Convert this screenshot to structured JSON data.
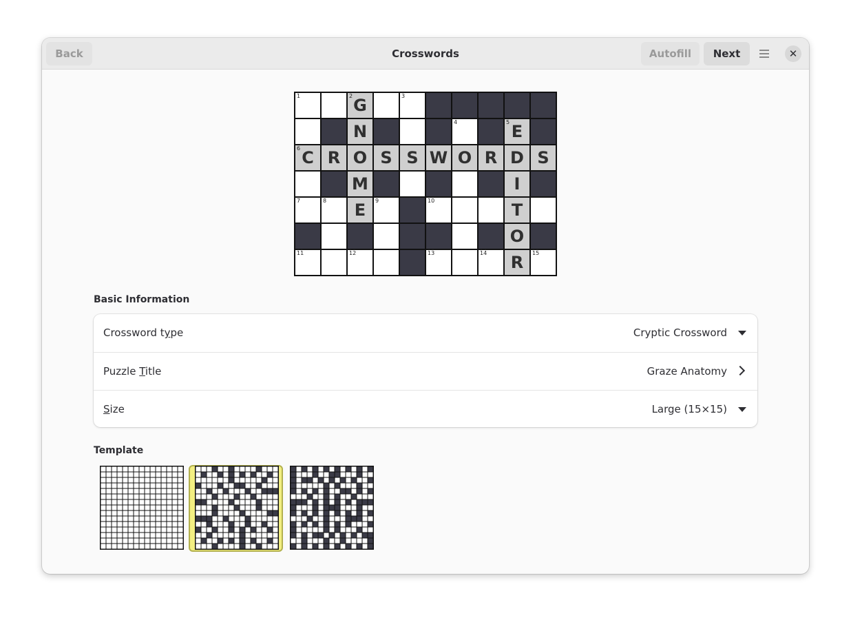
{
  "window": {
    "title": "Crosswords",
    "back_label": "Back",
    "autofill_label": "Autofill",
    "next_label": "Next",
    "menu_icon": "hamburger-menu-icon",
    "close_icon": "close-icon",
    "close_glyph": "✕"
  },
  "preview": {
    "rows": [
      [
        {
          "n": "1"
        },
        {},
        {
          "n": "2",
          "l": "G",
          "h": 1
        },
        {},
        {
          "n": "3"
        },
        {
          "b": 1
        },
        {
          "b": 1
        },
        {
          "b": 1
        },
        {
          "b": 1
        },
        {
          "b": 1
        }
      ],
      [
        {},
        {
          "b": 1
        },
        {
          "l": "N",
          "h": 1
        },
        {
          "b": 1
        },
        {},
        {
          "b": 1
        },
        {
          "n": "4"
        },
        {
          "b": 1
        },
        {
          "n": "5",
          "l": "E",
          "h": 1
        },
        {
          "b": 1
        }
      ],
      [
        {
          "n": "6",
          "l": "C",
          "h": 1
        },
        {
          "l": "R",
          "h": 1
        },
        {
          "l": "O",
          "h": 1
        },
        {
          "l": "S",
          "h": 1
        },
        {
          "l": "S",
          "h": 1
        },
        {
          "l": "W",
          "h": 1
        },
        {
          "l": "O",
          "h": 1
        },
        {
          "l": "R",
          "h": 1
        },
        {
          "l": "D",
          "h": 1
        },
        {
          "l": "S",
          "h": 1
        }
      ],
      [
        {},
        {
          "b": 1
        },
        {
          "l": "M",
          "h": 1
        },
        {
          "b": 1
        },
        {},
        {
          "b": 1
        },
        {},
        {
          "b": 1
        },
        {
          "l": "I",
          "h": 1
        },
        {
          "b": 1
        }
      ],
      [
        {
          "n": "7"
        },
        {
          "n": "8"
        },
        {
          "l": "E",
          "h": 1
        },
        {
          "n": "9"
        },
        {
          "b": 1
        },
        {
          "n": "10"
        },
        {},
        {},
        {
          "l": "T",
          "h": 1
        },
        {}
      ],
      [
        {
          "b": 1
        },
        {},
        {
          "b": 1
        },
        {},
        {
          "b": 1
        },
        {
          "b": 1
        },
        {},
        {
          "b": 1
        },
        {
          "l": "O",
          "h": 1
        },
        {
          "b": 1
        }
      ],
      [
        {
          "n": "11"
        },
        {},
        {
          "n": "12"
        },
        {},
        {
          "b": 1
        },
        {
          "n": "13"
        },
        {},
        {
          "n": "14"
        },
        {
          "l": "R",
          "h": 1
        },
        {
          "n": "15"
        }
      ]
    ]
  },
  "basic_info": {
    "heading": "Basic Information",
    "crossword_type": {
      "label_pre": "Crossword t",
      "label_mn": "y",
      "label_post": "pe",
      "value": "Cryptic Crossword"
    },
    "puzzle_title": {
      "label_pre": "Puzzle ",
      "label_mn": "T",
      "label_post": "itle",
      "value": "Graze Anatomy"
    },
    "size": {
      "label_pre": "",
      "label_mn": "S",
      "label_post": "ize",
      "value": "Large (15×15)"
    }
  },
  "template": {
    "heading": "Template",
    "selected_index": 1,
    "items": [
      {
        "name": "template-blank",
        "blocks": []
      },
      {
        "name": "template-sparse",
        "blocks": [
          [
            0,
            3
          ],
          [
            0,
            6
          ],
          [
            0,
            11
          ],
          [
            1,
            1
          ],
          [
            1,
            4
          ],
          [
            1,
            6
          ],
          [
            1,
            8
          ],
          [
            1,
            10
          ],
          [
            1,
            13
          ],
          [
            2,
            6
          ],
          [
            2,
            12
          ],
          [
            3,
            0
          ],
          [
            3,
            4
          ],
          [
            3,
            7
          ],
          [
            3,
            8
          ],
          [
            3,
            11
          ],
          [
            4,
            2
          ],
          [
            4,
            5
          ],
          [
            4,
            9
          ],
          [
            4,
            12
          ],
          [
            4,
            13
          ],
          [
            4,
            14
          ],
          [
            5,
            3
          ],
          [
            5,
            7
          ],
          [
            5,
            10
          ],
          [
            6,
            0
          ],
          [
            6,
            1
          ],
          [
            6,
            6
          ],
          [
            6,
            11
          ],
          [
            7,
            3
          ],
          [
            7,
            7
          ],
          [
            7,
            11
          ],
          [
            8,
            3
          ],
          [
            8,
            8
          ],
          [
            8,
            13
          ],
          [
            8,
            14
          ],
          [
            9,
            0
          ],
          [
            9,
            1
          ],
          [
            9,
            2
          ],
          [
            9,
            5
          ],
          [
            9,
            9
          ],
          [
            10,
            2
          ],
          [
            10,
            6
          ],
          [
            10,
            9
          ],
          [
            10,
            12
          ],
          [
            11,
            0
          ],
          [
            11,
            3
          ],
          [
            11,
            6
          ],
          [
            11,
            8
          ],
          [
            11,
            10
          ],
          [
            11,
            13
          ],
          [
            12,
            2
          ],
          [
            12,
            8
          ],
          [
            13,
            1
          ],
          [
            13,
            4
          ],
          [
            13,
            6
          ],
          [
            13,
            8
          ],
          [
            13,
            10
          ],
          [
            13,
            13
          ],
          [
            14,
            3
          ],
          [
            14,
            8
          ],
          [
            14,
            11
          ]
        ]
      },
      {
        "name": "template-dense",
        "blocks": [
          [
            0,
            0
          ],
          [
            0,
            2
          ],
          [
            0,
            4
          ],
          [
            0,
            6
          ],
          [
            0,
            8
          ],
          [
            0,
            10
          ],
          [
            0,
            12
          ],
          [
            0,
            14
          ],
          [
            1,
            0
          ],
          [
            1,
            4
          ],
          [
            1,
            7
          ],
          [
            1,
            8
          ],
          [
            1,
            12
          ],
          [
            2,
            0
          ],
          [
            2,
            2
          ],
          [
            2,
            3
          ],
          [
            2,
            5
          ],
          [
            2,
            7
          ],
          [
            2,
            9
          ],
          [
            2,
            11
          ],
          [
            2,
            14
          ],
          [
            3,
            0
          ],
          [
            3,
            6
          ],
          [
            3,
            8
          ],
          [
            3,
            12
          ],
          [
            4,
            0
          ],
          [
            4,
            2
          ],
          [
            4,
            4
          ],
          [
            4,
            6
          ],
          [
            4,
            9
          ],
          [
            4,
            10
          ],
          [
            4,
            12
          ],
          [
            4,
            14
          ],
          [
            5,
            3
          ],
          [
            5,
            6
          ],
          [
            5,
            8
          ],
          [
            5,
            11
          ],
          [
            6,
            0
          ],
          [
            6,
            1
          ],
          [
            6,
            2
          ],
          [
            6,
            4
          ],
          [
            6,
            6
          ],
          [
            6,
            8
          ],
          [
            6,
            10
          ],
          [
            6,
            12
          ],
          [
            6,
            13
          ],
          [
            6,
            14
          ],
          [
            7,
            0
          ],
          [
            7,
            4
          ],
          [
            7,
            6
          ],
          [
            7,
            7
          ],
          [
            7,
            8
          ],
          [
            7,
            12
          ],
          [
            8,
            0
          ],
          [
            8,
            2
          ],
          [
            8,
            4
          ],
          [
            8,
            6
          ],
          [
            8,
            8
          ],
          [
            8,
            10
          ],
          [
            8,
            12
          ],
          [
            8,
            14
          ],
          [
            9,
            3
          ],
          [
            9,
            6
          ],
          [
            9,
            10
          ],
          [
            9,
            11
          ],
          [
            9,
            12
          ],
          [
            10,
            0
          ],
          [
            10,
            2
          ],
          [
            10,
            4
          ],
          [
            10,
            6
          ],
          [
            10,
            8
          ],
          [
            10,
            10
          ],
          [
            10,
            14
          ],
          [
            11,
            0
          ],
          [
            11,
            6
          ],
          [
            11,
            8
          ],
          [
            11,
            12
          ],
          [
            12,
            0
          ],
          [
            12,
            2
          ],
          [
            12,
            4
          ],
          [
            12,
            5
          ],
          [
            12,
            7
          ],
          [
            12,
            9
          ],
          [
            12,
            11
          ],
          [
            12,
            13
          ],
          [
            12,
            14
          ],
          [
            13,
            2
          ],
          [
            13,
            6
          ],
          [
            13,
            9
          ],
          [
            13,
            14
          ],
          [
            14,
            0
          ],
          [
            14,
            2
          ],
          [
            14,
            4
          ],
          [
            14,
            6
          ],
          [
            14,
            8
          ],
          [
            14,
            10
          ],
          [
            14,
            12
          ],
          [
            14,
            14
          ]
        ]
      }
    ]
  }
}
